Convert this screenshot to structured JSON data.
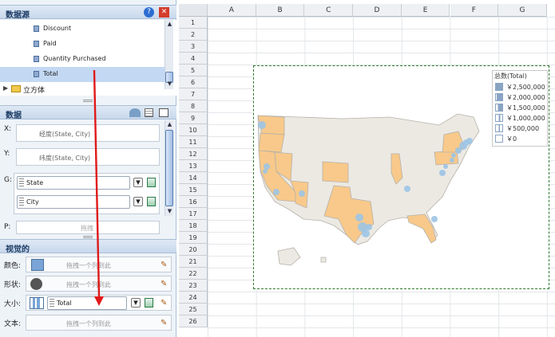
{
  "datasource": {
    "title": "数据源",
    "items": [
      "Discount",
      "Paid",
      "Quantity Purchased",
      "Total"
    ],
    "cube_label": "立方体"
  },
  "data_panel": {
    "title": "数据",
    "x_label": "X:",
    "x_value": "经度(State, City)",
    "y_label": "Y:",
    "y_value": "纬度(State, City)",
    "g_label": "G:",
    "g_items": [
      "State",
      "City"
    ],
    "p_label": "P:",
    "p_hint": "拖拽"
  },
  "visual_panel": {
    "title": "视觉的",
    "rows": [
      {
        "label": "颜色:",
        "hint": "拖拽一个列到此"
      },
      {
        "label": "形状:",
        "hint": "拖拽一个列到此"
      },
      {
        "label": "大小:",
        "value": "Total"
      },
      {
        "label": "文本:",
        "hint": "拖拽一个列到此"
      }
    ]
  },
  "grid": {
    "columns": [
      "A",
      "B",
      "C",
      "D",
      "E",
      "F",
      "G"
    ],
    "rows": [
      "1",
      "2",
      "3",
      "4",
      "5",
      "6",
      "7",
      "8",
      "9",
      "10",
      "11",
      "12",
      "13",
      "14",
      "15",
      "16",
      "17",
      "18",
      "19",
      "20",
      "21",
      "22",
      "23",
      "24",
      "25",
      "26"
    ]
  },
  "legend": {
    "title": "总数(Total)",
    "items": [
      "￥2,500,000",
      "￥2,000,000",
      "￥1,500,000",
      "￥1,000,000",
      "￥500,000",
      "￥0"
    ]
  },
  "chart_data": {
    "type": "map",
    "region": "United States",
    "highlighted_states": [
      "Washington",
      "Oregon",
      "California",
      "Nevada",
      "Arizona",
      "Colorado",
      "Texas",
      "Illinois",
      "New York",
      "Pennsylvania",
      "Florida"
    ],
    "legend_title": "总数(Total)",
    "size_scale": [
      2500000,
      2000000,
      1500000,
      1000000,
      500000,
      0
    ]
  },
  "colors": {
    "highlight": "#f8c98a",
    "state": "#ece9e3",
    "bubble": "#9cc4e4",
    "accent": "#2f7a2f"
  }
}
